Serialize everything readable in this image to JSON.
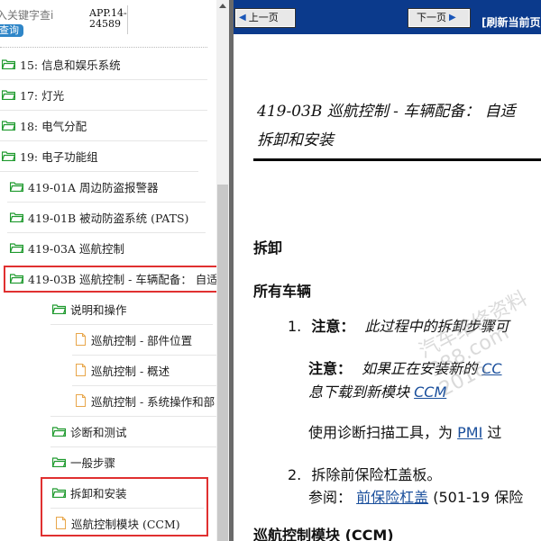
{
  "sidebar": {
    "search_placeholder": "入关键字查i",
    "search_button": "查询",
    "app_code": "APP.14-24589",
    "items": [
      {
        "label": "15: 信息和娱乐系统"
      },
      {
        "label": "17: 灯光"
      },
      {
        "label": "18: 电气分配"
      },
      {
        "label": "19: 电子功能组"
      },
      {
        "label": "419-01A 周边防盗报警器"
      },
      {
        "label": "419-01B 被动防盗系统 (PATS)"
      },
      {
        "label": "419-03A 巡航控制"
      },
      {
        "label": "419-03B 巡航控制 - 车辆配备： 自适"
      },
      {
        "label": "说明和操作"
      },
      {
        "label": "巡航控制 - 部件位置"
      },
      {
        "label": "巡航控制 - 概述"
      },
      {
        "label": "巡航控制 - 系统操作和部"
      },
      {
        "label": "诊断和测试"
      },
      {
        "label": "一般步骤"
      },
      {
        "label": "拆卸和安装"
      },
      {
        "label": "巡航控制模块 (CCM)"
      }
    ]
  },
  "toolbar": {
    "prev_label": "上一页",
    "next_label": "下一页",
    "refresh_label": "[刷新当前页"
  },
  "document": {
    "title_line1": "419-03B 巡航控制 - 车辆配备： 自适",
    "title_line2": "拆卸和安装",
    "heading_remove": "拆卸",
    "heading_all": "所有车辆",
    "step1_num": "1.",
    "step1_note_label": "注意：",
    "step1_note_text": "此过程中的拆卸步骤可",
    "step1_note2_label": "注意：",
    "step1_note2_text": "如果正在安装新的",
    "step1_note2_link": "CC",
    "step1_note2_line2_text": "息下载到新模块",
    "step1_note2_line2_link": "CCM",
    "step1_use_text": "使用诊断扫描工具，为",
    "step1_use_link": "PMI",
    "step1_use_tail": "过",
    "step2_num": "2.",
    "step2_text": "拆除前保险杠盖板。",
    "step2_ref_label": "参阅：",
    "step2_ref_link": "前保险杠盖",
    "step2_ref_tail": "(501-19 保险",
    "section_cut": "巡航控制模块 (CCM)"
  },
  "watermark": "汽车维修资料 388.com 2016",
  "colors": {
    "toolbar_bg": "#0b3a8c",
    "folder_green": "#1f9a2e",
    "doc_orange": "#e8a64a",
    "highlight_red": "#e03030",
    "link_blue": "#1a4f9c"
  }
}
